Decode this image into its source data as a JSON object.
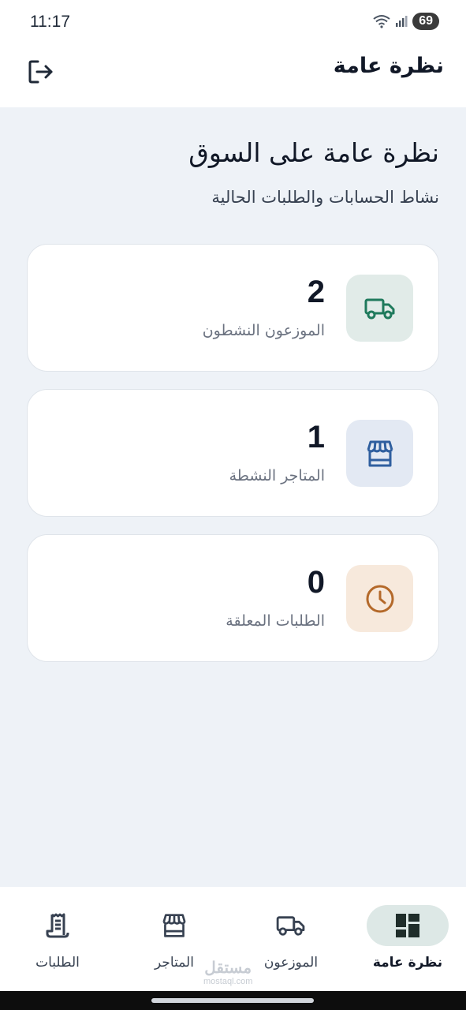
{
  "status_bar": {
    "time": "11:17",
    "battery": "69"
  },
  "header": {
    "title": "نظرة عامة"
  },
  "overview": {
    "heading": "نظرة عامة على السوق",
    "subheading": "نشاط الحسابات والطلبات الحالية"
  },
  "cards": [
    {
      "value": "2",
      "label": "الموزعون النشطون",
      "icon": "truck-icon",
      "icon_bg": "#e1ebe8",
      "icon_color": "#1f7a5c"
    },
    {
      "value": "1",
      "label": "المتاجر النشطة",
      "icon": "store-icon",
      "icon_bg": "#e3e9f3",
      "icon_color": "#2f5f9f"
    },
    {
      "value": "0",
      "label": "الطلبات المعلقة",
      "icon": "clock-icon",
      "icon_bg": "#f7e9dc",
      "icon_color": "#b4692a"
    }
  ],
  "bottom_nav": {
    "items": [
      {
        "label": "نظرة عامة",
        "icon": "dashboard-icon",
        "active": true
      },
      {
        "label": "الموزعون",
        "icon": "truck-icon",
        "active": false
      },
      {
        "label": "المتاجر",
        "icon": "store-icon",
        "active": false
      },
      {
        "label": "الطلبات",
        "icon": "receipt-icon",
        "active": false
      }
    ]
  },
  "watermark": {
    "line1": "مستقل",
    "line2": "mostaql.com"
  },
  "colors": {
    "background": "#eef2f7",
    "surface": "#ffffff",
    "accent": "#1f7a5c"
  }
}
